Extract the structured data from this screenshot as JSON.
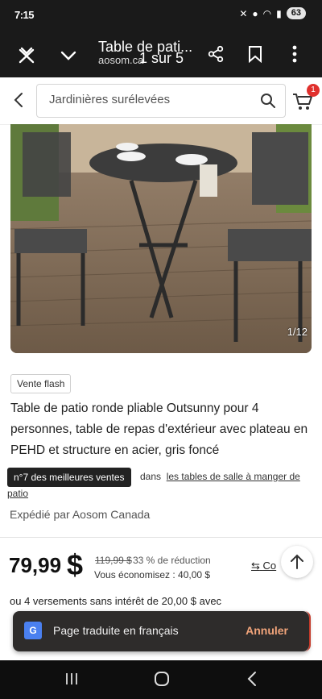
{
  "status_bar": {
    "time": "7:15",
    "battery": "63"
  },
  "browser": {
    "title": "Table de pati...",
    "url": "aosom.ca",
    "page_counter": "1 sur 5"
  },
  "search": {
    "placeholder": "Jardinières surélevées",
    "cart_count": "1"
  },
  "product": {
    "image_counter": "1/12",
    "flash_label": "Vente flash",
    "title": "Table de patio ronde pliable Outsunny pour 4 personnes, table de repas d'extérieur avec plateau en PEHD et structure en acier, gris foncé",
    "best_seller_badge": "n°7 des meilleures ventes",
    "best_seller_in": "dans",
    "best_seller_link": "les tables de salle à manger de",
    "best_seller_link2": "patio",
    "shipped_by": "Expédié par Aosom Canada",
    "price": "79,99",
    "currency": "$",
    "old_price": "119,99 $",
    "discount": "33 % de réduction",
    "savings": "Vous économisez : 40,00 $",
    "compare": "Co",
    "installments": "ou 4 versements sans intérêt de 20,00 $ avec"
  },
  "toast": {
    "message": "Page traduite en français",
    "action": "Annuler",
    "icon_letter": "G"
  }
}
